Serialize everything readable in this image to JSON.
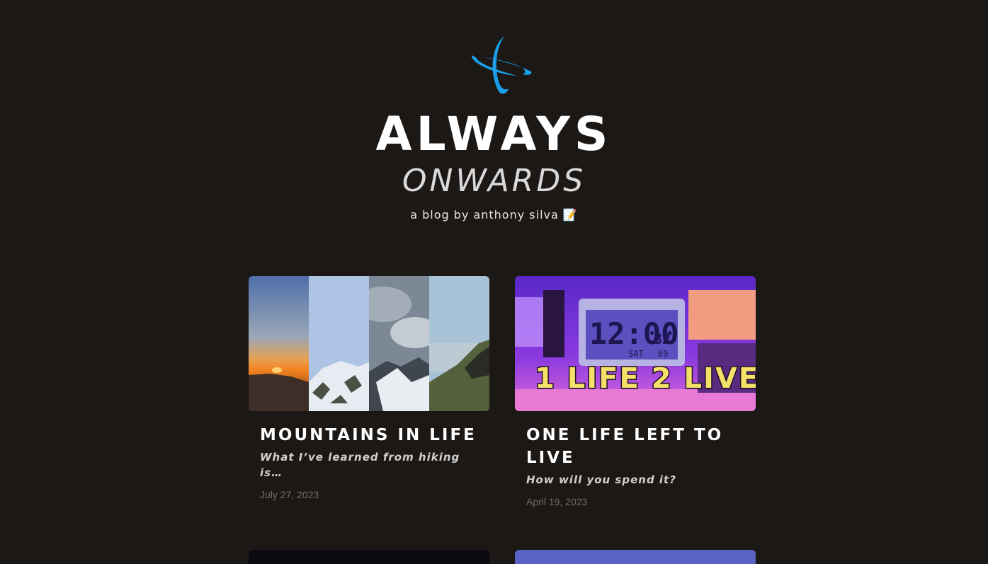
{
  "site": {
    "title": "ALWAYS",
    "subtitle": "ONWARDS",
    "tagline": "a blog by anthony silva 📝",
    "logo_icon": "orbit-logo-icon",
    "accent": "#1a9fea",
    "background": "#1c1816"
  },
  "posts": [
    {
      "title": "MOUNTAINS IN LIFE",
      "subtitle": "What I’ve learned from hiking is…",
      "date": "July 27, 2023",
      "image_icon": "mountain-collage-image"
    },
    {
      "title": "ONE LIFE LEFT TO LIVE",
      "subtitle": "How will you spend it?",
      "date": "April 19, 2023",
      "image_icon": "alarm-clock-image",
      "image_text": {
        "clock_time": "12:00",
        "clock_seconds": "32",
        "clock_day": "SAT",
        "clock_temp": "69",
        "overlay": "1 LIFE 2 LIVE"
      }
    }
  ]
}
